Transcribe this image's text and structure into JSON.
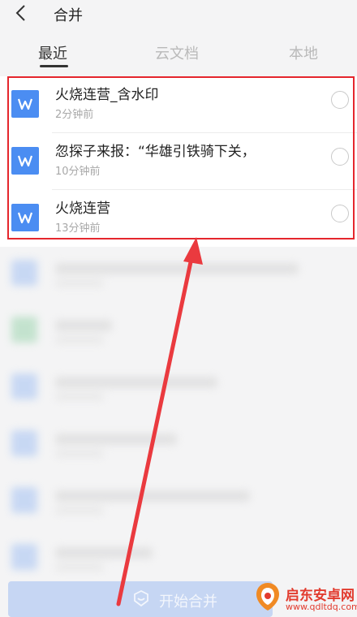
{
  "header": {
    "title": "合并"
  },
  "tabs": [
    {
      "label": "最近",
      "active": true
    },
    {
      "label": "云文档",
      "active": false
    },
    {
      "label": "本地",
      "active": false
    }
  ],
  "files": [
    {
      "name": "火烧连营_含水印",
      "time": "2分钟前",
      "selected": false
    },
    {
      "name": "忽探子来报：“华雄引铁骑下关，",
      "time": "10分钟前",
      "selected": false
    },
    {
      "name": "火烧连营",
      "time": "13分钟前",
      "selected": false
    }
  ],
  "footer": {
    "merge_label": "开始合并"
  },
  "watermark": {
    "name": "启东安卓网",
    "url": "www.qdltdq.com"
  },
  "colors": {
    "accent": "#4b8df2",
    "highlight": "#e5262d",
    "merge_button": "#c6d6f3"
  }
}
